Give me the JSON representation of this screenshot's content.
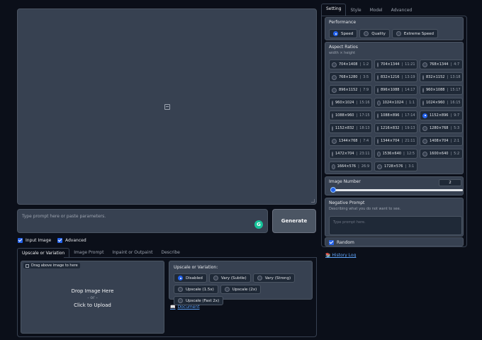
{
  "prompt": {
    "placeholder": "Type prompt here or paste parameters."
  },
  "generate_label": "Generate",
  "checkboxes": {
    "input_image": "Input Image",
    "advanced": "Advanced"
  },
  "bottom_tabs": [
    "Upscale or Variation",
    "Image Prompt",
    "Inpaint or Outpaint",
    "Describe"
  ],
  "upload": {
    "hint": "Drag above image to here",
    "line1": "Drop Image Here",
    "line2": "- or -",
    "line3": "Click to Upload"
  },
  "upscale": {
    "title": "Upscale or Variation:",
    "options": [
      "Disabled",
      "Vary (Subtle)",
      "Vary (Strong)",
      "Upscale (1.5x)",
      "Upscale (2x)",
      "Upscale (Fast 2x)"
    ],
    "selected": "Disabled"
  },
  "document_link": "Document",
  "right_tabs": [
    "Setting",
    "Style",
    "Model",
    "Advanced"
  ],
  "performance": {
    "title": "Performance",
    "options": [
      "Speed",
      "Quality",
      "Extreme Speed"
    ],
    "selected": "Speed"
  },
  "aspect": {
    "title": "Aspect Ratios",
    "subtitle": "width × height",
    "selected": "1152×896",
    "items": [
      {
        "size": "704×1408",
        "ratio": "1:2"
      },
      {
        "size": "704×1344",
        "ratio": "11:21"
      },
      {
        "size": "768×1344",
        "ratio": "4:7"
      },
      {
        "size": "768×1280",
        "ratio": "3:5"
      },
      {
        "size": "832×1216",
        "ratio": "13:19"
      },
      {
        "size": "832×1152",
        "ratio": "13:18"
      },
      {
        "size": "896×1152",
        "ratio": "7:9"
      },
      {
        "size": "896×1088",
        "ratio": "14:17"
      },
      {
        "size": "960×1088",
        "ratio": "15:17"
      },
      {
        "size": "960×1024",
        "ratio": "15:16"
      },
      {
        "size": "1024×1024",
        "ratio": "1:1"
      },
      {
        "size": "1024×960",
        "ratio": "16:15"
      },
      {
        "size": "1088×960",
        "ratio": "17:15"
      },
      {
        "size": "1088×896",
        "ratio": "17:14"
      },
      {
        "size": "1152×896",
        "ratio": "9:7"
      },
      {
        "size": "1152×832",
        "ratio": "18:13"
      },
      {
        "size": "1216×832",
        "ratio": "19:13"
      },
      {
        "size": "1280×768",
        "ratio": "5:3"
      },
      {
        "size": "1344×768",
        "ratio": "7:4"
      },
      {
        "size": "1344×704",
        "ratio": "21:11"
      },
      {
        "size": "1408×704",
        "ratio": "2:1"
      },
      {
        "size": "1472×704",
        "ratio": "23:11"
      },
      {
        "size": "1536×640",
        "ratio": "12:5"
      },
      {
        "size": "1600×640",
        "ratio": "5:2"
      },
      {
        "size": "1664×576",
        "ratio": "26:9"
      },
      {
        "size": "1728×576",
        "ratio": "3:1"
      }
    ]
  },
  "image_number": {
    "title": "Image Number",
    "value": "2",
    "fraction": 0.0
  },
  "negative_prompt": {
    "title": "Negative Prompt",
    "subtitle": "Describing what you do not want to see.",
    "placeholder": "Type prompt here."
  },
  "random_label": "Random",
  "history_link": "History Log",
  "colors": {
    "background": "#0b0f19",
    "panel": "#374151",
    "accent": "#2563eb",
    "link": "#60a5fa"
  }
}
